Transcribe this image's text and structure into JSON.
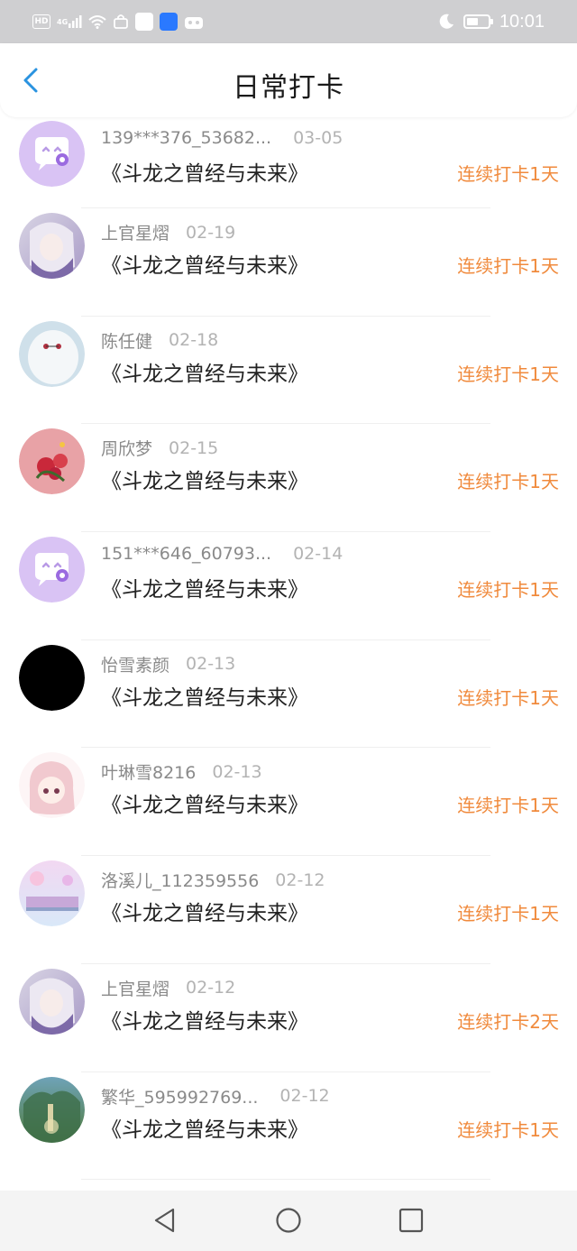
{
  "status_bar": {
    "left_icons": [
      "hd-icon",
      "4g-signal-icon",
      "wifi-icon",
      "bag-icon",
      "app-icon",
      "bulb-icon",
      "game-icon"
    ],
    "net_label": "4G",
    "hd_label": "HD",
    "time": "10:01"
  },
  "header": {
    "title": "日常打卡"
  },
  "accent_color": "#f08a3c",
  "items": [
    {
      "name": "139***376_53682...",
      "date": "03-05",
      "book": "《斗龙之曾经与未来》",
      "streak": "连续打卡1天",
      "avatar": "default-chat-avatar"
    },
    {
      "name": "上官星熠",
      "date": "02-19",
      "book": "《斗龙之曾经与未来》",
      "streak": "连续打卡1天",
      "avatar": "anime-girl-avatar"
    },
    {
      "name": "陈任健",
      "date": "02-18",
      "book": "《斗龙之曾经与未来》",
      "streak": "连续打卡1天",
      "avatar": "white-robot-avatar"
    },
    {
      "name": "周欣梦",
      "date": "02-15",
      "book": "《斗龙之曾经与未来》",
      "streak": "连续打卡1天",
      "avatar": "red-flower-avatar"
    },
    {
      "name": "151***646_60793...",
      "date": "02-14",
      "book": "《斗龙之曾经与未来》",
      "streak": "连续打卡1天",
      "avatar": "default-chat-avatar"
    },
    {
      "name": "怡雪素颜",
      "date": "02-13",
      "book": "《斗龙之曾经与未来》",
      "streak": "连续打卡1天",
      "avatar": "black-avatar"
    },
    {
      "name": "叶琳雪8216",
      "date": "02-13",
      "book": "《斗龙之曾经与未来》",
      "streak": "连续打卡1天",
      "avatar": "pink-hair-girl-avatar"
    },
    {
      "name": "洛溪儿_112359556",
      "date": "02-12",
      "book": "《斗龙之曾经与未来》",
      "streak": "连续打卡1天",
      "avatar": "pastel-scene-avatar"
    },
    {
      "name": "上官星熠",
      "date": "02-12",
      "book": "《斗龙之曾经与未来》",
      "streak": "连续打卡2天",
      "avatar": "anime-girl-avatar"
    },
    {
      "name": "繁华_595992769...",
      "date": "02-12",
      "book": "《斗龙之曾经与未来》",
      "streak": "连续打卡1天",
      "avatar": "forest-scene-avatar"
    }
  ]
}
